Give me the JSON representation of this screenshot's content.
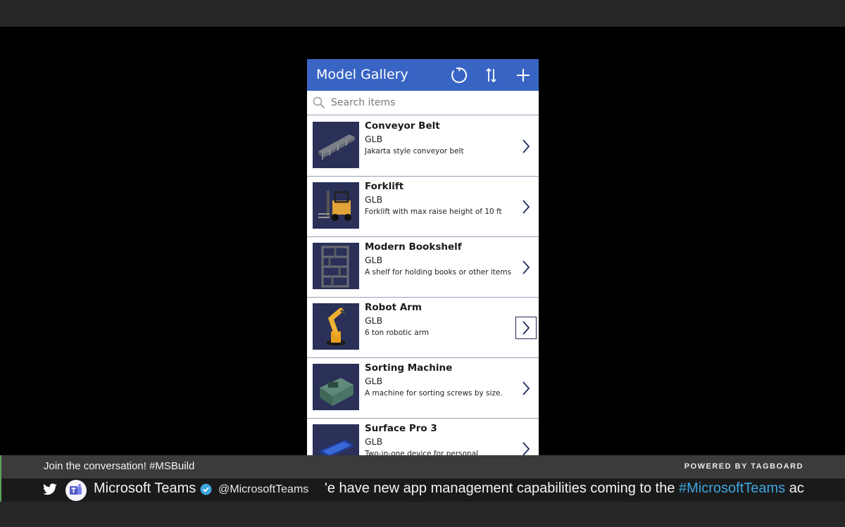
{
  "app": {
    "title": "Model Gallery",
    "header_icons": [
      "refresh-icon",
      "sort-icon",
      "add-icon"
    ],
    "accent_color": "#3864c4"
  },
  "search": {
    "placeholder": "Search items",
    "value": ""
  },
  "items": [
    {
      "title": "Conveyor Belt",
      "type": "GLB",
      "description": "Jakarta style conveyor belt",
      "thumbnail_icon": "conveyor-belt-thumbnail"
    },
    {
      "title": "Forklift",
      "type": "GLB",
      "description": "Forklift with max raise height of 10 ft",
      "thumbnail_icon": "forklift-thumbnail"
    },
    {
      "title": "Modern Bookshelf",
      "type": "GLB",
      "description": "A shelf for holding books or other items",
      "thumbnail_icon": "bookshelf-thumbnail"
    },
    {
      "title": "Robot Arm",
      "type": "GLB",
      "description": "6 ton robotic arm",
      "thumbnail_icon": "robot-arm-thumbnail",
      "focused": true
    },
    {
      "title": "Sorting Machine",
      "type": "GLB",
      "description": "A machine for sorting screws by size.",
      "thumbnail_icon": "sorting-machine-thumbnail"
    },
    {
      "title": "Surface Pro 3",
      "type": "GLB",
      "description": "Two-in-one device for personal",
      "thumbnail_icon": "surface-pro-thumbnail"
    }
  ],
  "banner": {
    "join_text": "Join the conversation! #MSBuild",
    "powered_by": "POWERED BY TAGBOARD",
    "account_name": "Microsoft Teams",
    "handle": "@MicrosoftTeams",
    "ticker_prefix": "'e have new app management capabilities coming to the ",
    "ticker_hashtag": "#MicrosoftTeams",
    "ticker_suffix": " ac",
    "hashtag_color": "#3ea6e0"
  }
}
